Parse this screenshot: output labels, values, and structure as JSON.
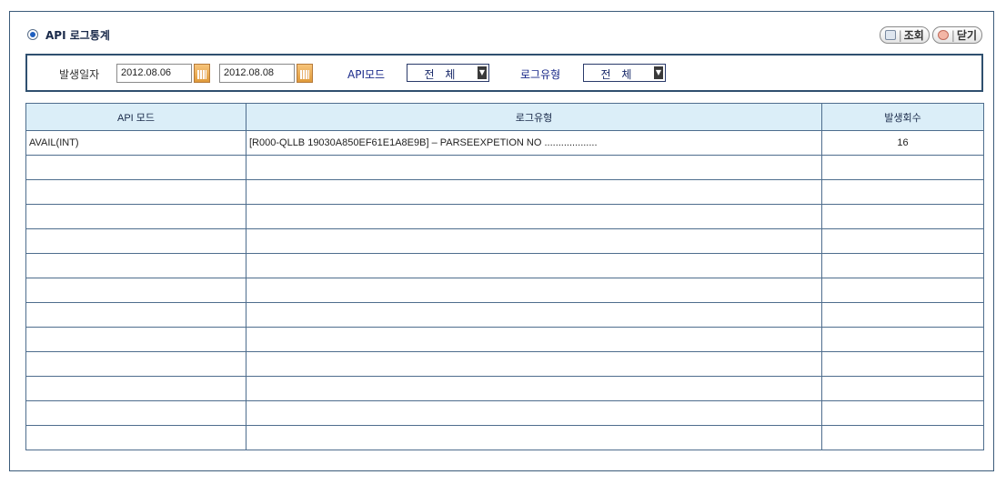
{
  "page": {
    "title": "API 로그통계"
  },
  "buttons": {
    "search_label": "조회",
    "close_label": "닫기",
    "separator": "|"
  },
  "filters": {
    "date_label": "발생일자",
    "date_from": "2012.08.06",
    "date_to": "2012.08.08",
    "api_mode_label": "API모드",
    "api_mode_value": "전 체",
    "log_type_label": "로그유형",
    "log_type_value": "전 체"
  },
  "table": {
    "columns": [
      "API 모드",
      "로그유형",
      "발생회수"
    ],
    "rows": [
      [
        "AVAIL(INT)",
        "[R000-QLLB 19030A850EF61E1A8E9B] – PARSEEXPETION NO ...................",
        "16"
      ],
      [
        "",
        "",
        ""
      ],
      [
        "",
        "",
        ""
      ],
      [
        "",
        "",
        ""
      ],
      [
        "",
        "",
        ""
      ],
      [
        "",
        "",
        ""
      ],
      [
        "",
        "",
        ""
      ],
      [
        "",
        "",
        ""
      ],
      [
        "",
        "",
        ""
      ],
      [
        "",
        "",
        ""
      ],
      [
        "",
        "",
        ""
      ],
      [
        "",
        "",
        ""
      ],
      [
        "",
        "",
        ""
      ]
    ]
  }
}
